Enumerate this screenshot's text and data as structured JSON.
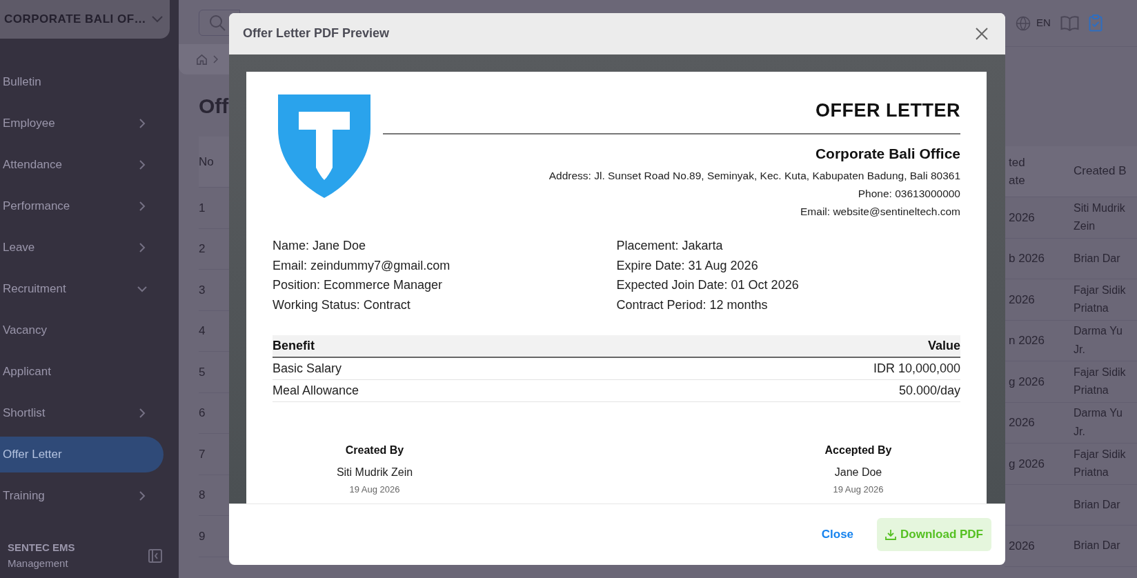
{
  "sidebar": {
    "org_selector": "CORPORATE BALI OF…",
    "items": [
      {
        "label": "Bulletin",
        "kind": "link",
        "selected": false
      },
      {
        "label": "Employee",
        "kind": "group",
        "expanded": false,
        "selected": false
      },
      {
        "label": "Attendance",
        "kind": "group",
        "expanded": false,
        "selected": false
      },
      {
        "label": "Performance",
        "kind": "group",
        "expanded": false,
        "selected": false
      },
      {
        "label": "Leave",
        "kind": "group",
        "expanded": false,
        "selected": false
      },
      {
        "label": "Recruitment",
        "kind": "group",
        "expanded": true,
        "selected": false,
        "children": [
          {
            "label": "Vacancy",
            "kind": "link",
            "selected": false
          },
          {
            "label": "Applicant",
            "kind": "link",
            "selected": false
          },
          {
            "label": "Shortlist",
            "kind": "group",
            "expanded": false,
            "selected": false
          },
          {
            "label": "Offer Letter",
            "kind": "link",
            "selected": true
          }
        ]
      },
      {
        "label": "Training",
        "kind": "group",
        "expanded": false,
        "selected": false
      }
    ],
    "footer": {
      "title": "SENTEC EMS",
      "subtitle": "Management"
    }
  },
  "topbar": {
    "language": "EN"
  },
  "page_title": "Off",
  "table": {
    "columns": [
      {
        "lines": [
          "No"
        ]
      },
      {
        "lines": [
          "ted",
          "ate"
        ]
      },
      {
        "lines": [
          "Created B"
        ]
      }
    ],
    "rows": [
      {
        "no": "1",
        "date": "2026",
        "created_by": "Siti Mudrik Zein"
      },
      {
        "no": "2",
        "date": "b 2026",
        "created_by": "Brian Dar"
      },
      {
        "no": "3",
        "date": "2026",
        "created_by": "Fajar Sidik Priatna"
      },
      {
        "no": "4",
        "date": "n 2026",
        "created_by": "Darma Yu Jr."
      },
      {
        "no": "5",
        "date": "g 2026",
        "created_by": "Fajar Sidik Priatna"
      },
      {
        "no": "6",
        "date": "2026",
        "created_by": "Darma Yu Jr."
      },
      {
        "no": "7",
        "date": "g 2026",
        "created_by": "Fajar Sidik Priatna"
      },
      {
        "no": "8",
        "date": "",
        "created_by": "Brian Dar"
      },
      {
        "no": "9",
        "date": "2026",
        "created_by": "Brian Dar"
      }
    ]
  },
  "modal": {
    "title": "Offer Letter PDF Preview",
    "letter": {
      "heading": "OFFER LETTER",
      "company": "Corporate Bali Office",
      "contact": [
        "Address: Jl. Sunset Road No.89, Seminyak, Kec. Kuta, Kabupaten Badung, Bali 80361",
        "Phone: 03613000000",
        "Email: website@sentineltech.com"
      ],
      "details_left": [
        "Name: Jane Doe",
        "Email: zeindummy7@gmail.com",
        "Position: Ecommerce Manager",
        "Working Status: Contract"
      ],
      "details_right": [
        "Placement: Jakarta",
        "Expire Date: 31 Aug 2026",
        "Expected Join Date: 01 Oct 2026",
        "Contract Period: 12 months"
      ],
      "benefits": {
        "columns": [
          "Benefit",
          "Value"
        ],
        "rows": [
          [
            "Basic Salary",
            "IDR 10,000,000"
          ],
          [
            "Meal Allowance",
            "50.000/day"
          ]
        ]
      },
      "signatures": [
        {
          "label": "Created By",
          "name": "Siti Mudrik Zein",
          "date": "19 Aug 2026"
        },
        {
          "label": "Accepted By",
          "name": "Jane Doe",
          "date": "19 Aug 2026"
        }
      ]
    },
    "buttons": {
      "close": "Close",
      "download": "Download PDF"
    }
  }
}
